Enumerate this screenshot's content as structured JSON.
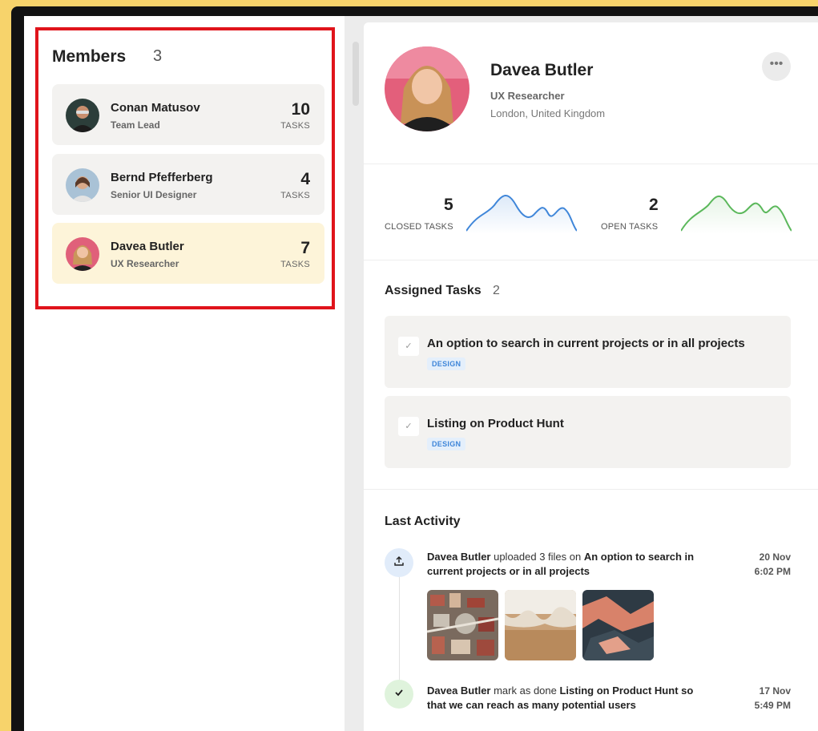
{
  "members": {
    "title": "Members",
    "count": "3",
    "list": [
      {
        "name": "Conan Matusov",
        "role": "Team Lead",
        "tasks": "10",
        "tasks_label": "TASKS"
      },
      {
        "name": "Bernd Pfefferberg",
        "role": "Senior UI Designer",
        "tasks": "4",
        "tasks_label": "TASKS"
      },
      {
        "name": "Davea Butler",
        "role": "UX Researcher",
        "tasks": "7",
        "tasks_label": "TASKS"
      }
    ]
  },
  "profile": {
    "name": "Davea Butler",
    "role": "UX Researcher",
    "location": "London, United Kingdom",
    "more_icon": "more-horizontal-icon"
  },
  "stats": {
    "closed": {
      "value": "5",
      "label": "CLOSED TASKS",
      "color": "#3f86d9"
    },
    "open": {
      "value": "2",
      "label": "OPEN TASKS",
      "color": "#5bb85b"
    }
  },
  "assigned": {
    "title": "Assigned Tasks",
    "count": "2",
    "tasks": [
      {
        "title": "An option to search in current projects or in all projects",
        "tag": "DESIGN"
      },
      {
        "title": "Listing on Product Hunt",
        "tag": "DESIGN"
      }
    ]
  },
  "activity": {
    "title": "Last Activity",
    "items": [
      {
        "user": "Davea Butler",
        "action": " uploaded 3 files on ",
        "target": "An option to search in current projects or in all projects",
        "date": "20 Nov",
        "time": "6:02 PM",
        "icon": "upload-icon"
      },
      {
        "user": "Davea Butler",
        "action": " mark as done ",
        "target": "Listing on Product Hunt so that we can reach as many potential users",
        "date": "17 Nov",
        "time": "5:49 PM",
        "icon": "check-icon"
      }
    ]
  },
  "colors": {
    "highlight": "#e0141b",
    "active_member": "#fdf4d9",
    "accent_blue": "#3f86d9",
    "accent_green": "#5bb85b"
  }
}
